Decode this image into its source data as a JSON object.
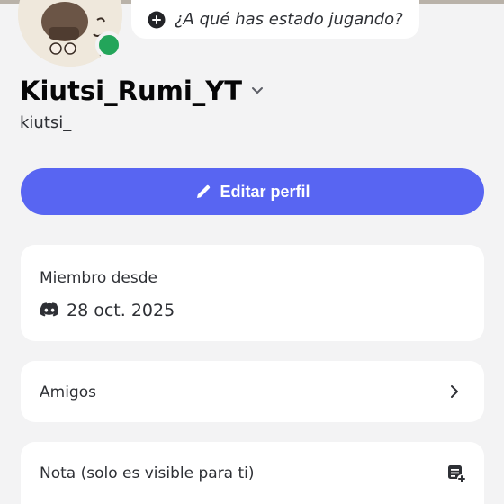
{
  "status": {
    "placeholder": "¿A qué has estado jugando?",
    "online_color": "#23a55a"
  },
  "profile": {
    "display_name": "Kiutsi_Rumi_YT",
    "username": "kiutsi_",
    "avatar_icon": "avatar-image"
  },
  "actions": {
    "edit_profile_label": "Editar perfil",
    "accent_color": "#5865f2"
  },
  "member_since": {
    "title": "Miembro desde",
    "date": "28 oct. 2025",
    "icon": "discord-icon"
  },
  "friends": {
    "label": "Amigos",
    "icon": "chevron-right-icon"
  },
  "note": {
    "label": "Nota (solo es visible para ti)",
    "icon": "note-add-icon"
  }
}
